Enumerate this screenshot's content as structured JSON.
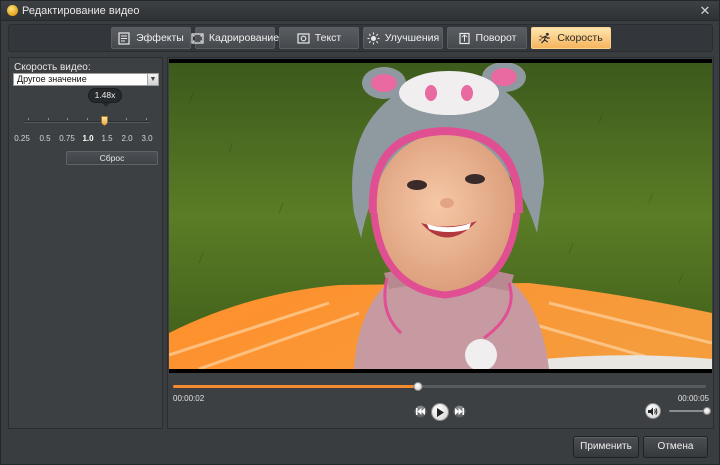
{
  "window": {
    "title": "Редактирование видео",
    "close_glyph": "✕"
  },
  "tabs": [
    {
      "label": "Эффекты",
      "icon": "effects-icon",
      "active": false
    },
    {
      "label": "Кадрирование",
      "icon": "crop-film-icon",
      "active": false
    },
    {
      "label": "Текст",
      "icon": "text-icon",
      "active": false
    },
    {
      "label": "Улучшения",
      "icon": "enhance-sun-icon",
      "active": false
    },
    {
      "label": "Поворот",
      "icon": "rotate-icon",
      "active": false
    },
    {
      "label": "Скорость",
      "icon": "speed-runner-icon",
      "active": true
    }
  ],
  "speed_panel": {
    "label": "Скорость видео:",
    "select_value": "Другое значение",
    "current_speed_label": "1.48x",
    "current_speed": 1.48,
    "scale_values": [
      "0.25",
      "0.5",
      "0.75",
      "1.0",
      "1.5",
      "2.0",
      "3.0"
    ],
    "highlighted_value": "1.0",
    "reset_label": "Сброс"
  },
  "player": {
    "current_time": "00:00:02",
    "total_time": "00:00:05",
    "progress_fraction": 0.46,
    "volume_fraction": 1.0
  },
  "footer": {
    "apply_label": "Применить",
    "cancel_label": "Отмена"
  },
  "colors": {
    "accent_orange": "#f28a30",
    "active_tab": "#f6b45d",
    "background": "#3a3d40"
  }
}
